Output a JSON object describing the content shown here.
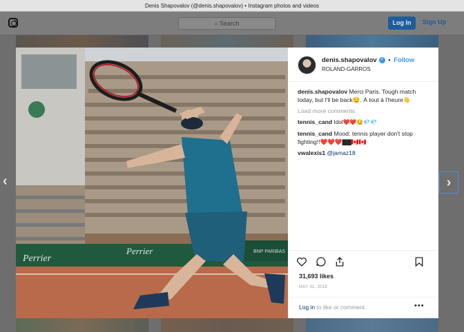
{
  "window": {
    "title": "Denis Shapovalov (@denis.shapovalov) • Instagram photos and videos"
  },
  "header": {
    "logo": "instagram-icon",
    "search_placeholder": "Search",
    "login_label": "Log In",
    "signup_label": "Sign Up"
  },
  "post": {
    "username": "denis.shapovalov",
    "separator": "•",
    "follow_label": "Follow",
    "location": "ROLAND-GARROS",
    "caption_user": "denis.shapovalov",
    "caption_text": "Merci Paris. Tough match today, but I'll be back😏. À tout à l'heure👋",
    "load_more": "Load more comments",
    "comments": [
      {
        "user": "tennis_cand",
        "text": "Idol❤️❤️😏💎💎"
      },
      {
        "user": "tennis_cand",
        "text": "Mood: tennis player don't stop fighting!!❤️❤️❤️▇▇🇨🇦🇨🇦"
      },
      {
        "user": "vwalexis1",
        "text": "@jamaz18"
      }
    ],
    "likes": "31,693 likes",
    "date": "MAY 31, 2018",
    "login_link": "Log in",
    "login_rest": " to like or comment.",
    "more": "•••"
  },
  "photo": {
    "banners": [
      "Perrier",
      "Perrier",
      "BNP PARIBAS"
    ]
  },
  "colors": {
    "accent": "#3897f0",
    "login_button": "#1c5d9c",
    "court": "#b86a4a"
  }
}
